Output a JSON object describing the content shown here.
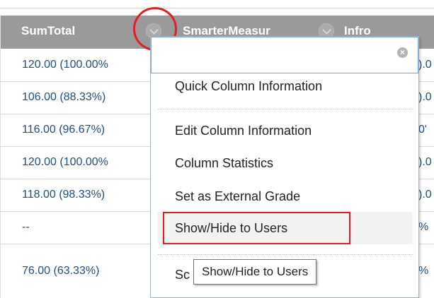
{
  "grid": {
    "headers": [
      {
        "label": "SumTotal"
      },
      {
        "label": "SmarterMeasur"
      },
      {
        "label": "Infro"
      }
    ],
    "sum_column": [
      "120.00 (100.00%",
      "106.00 (88.33%)",
      "116.00 (96.67%)",
      "120.00 (100.00%",
      "118.00 (98.33%)",
      "--",
      "76.00 (63.33%)"
    ],
    "edge_column": [
      ").0",
      ").0",
      "0'",
      ").0",
      ").0",
      "%",
      "%"
    ]
  },
  "menu": {
    "close_glyph": "×",
    "items": [
      {
        "label": "Quick Column Information"
      },
      {
        "label": "Edit Column Information"
      },
      {
        "label": "Column Statistics"
      },
      {
        "label": "Set as External Grade"
      },
      {
        "label": "Show/Hide to Users"
      },
      {
        "label": "Sc"
      }
    ]
  },
  "tooltip": {
    "text": "Show/Hide to Users"
  },
  "colors": {
    "header_bg": "#9a9a9a",
    "link_blue": "#1d4f82",
    "annotation_red": "#e31d24",
    "menu_border": "#7aa7d8"
  },
  "icons": {
    "header_menu": "chevron-down-icon",
    "close": "close-icon"
  }
}
